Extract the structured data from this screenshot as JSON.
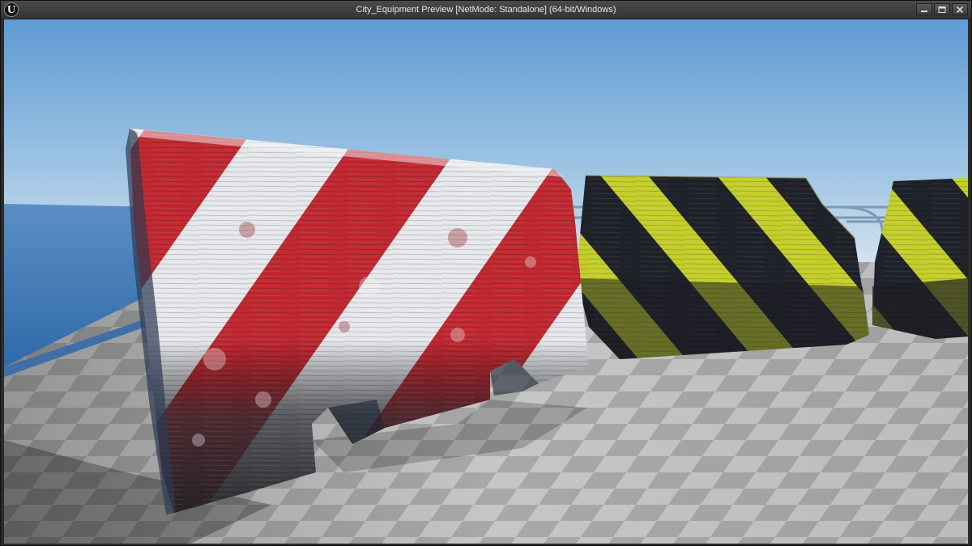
{
  "window": {
    "title": "City_Equipment Preview [NetMode: Standalone]  (64-bit/Windows)",
    "logo_glyph": "U",
    "controls": [
      {
        "name": "minimize-button",
        "icon": "minimize-icon"
      },
      {
        "name": "maximize-button",
        "icon": "maximize-icon"
      },
      {
        "name": "close-button",
        "icon": "close-icon"
      }
    ]
  },
  "viewport": {
    "scene": "3d-preview",
    "colors": {
      "sky_top": "#6aa2d6",
      "sky_horizon": "#c9dcea",
      "ocean": "#3f79b8",
      "floor_light": "#c4c4c4",
      "floor_dark": "#a9a9a9",
      "barrier_red": "#c42630",
      "barrier_white": "#e8eaee",
      "barrier_concrete": "#4a4d53",
      "hazard_yellow": "#c7d12a",
      "hazard_black": "#1f2228"
    }
  }
}
